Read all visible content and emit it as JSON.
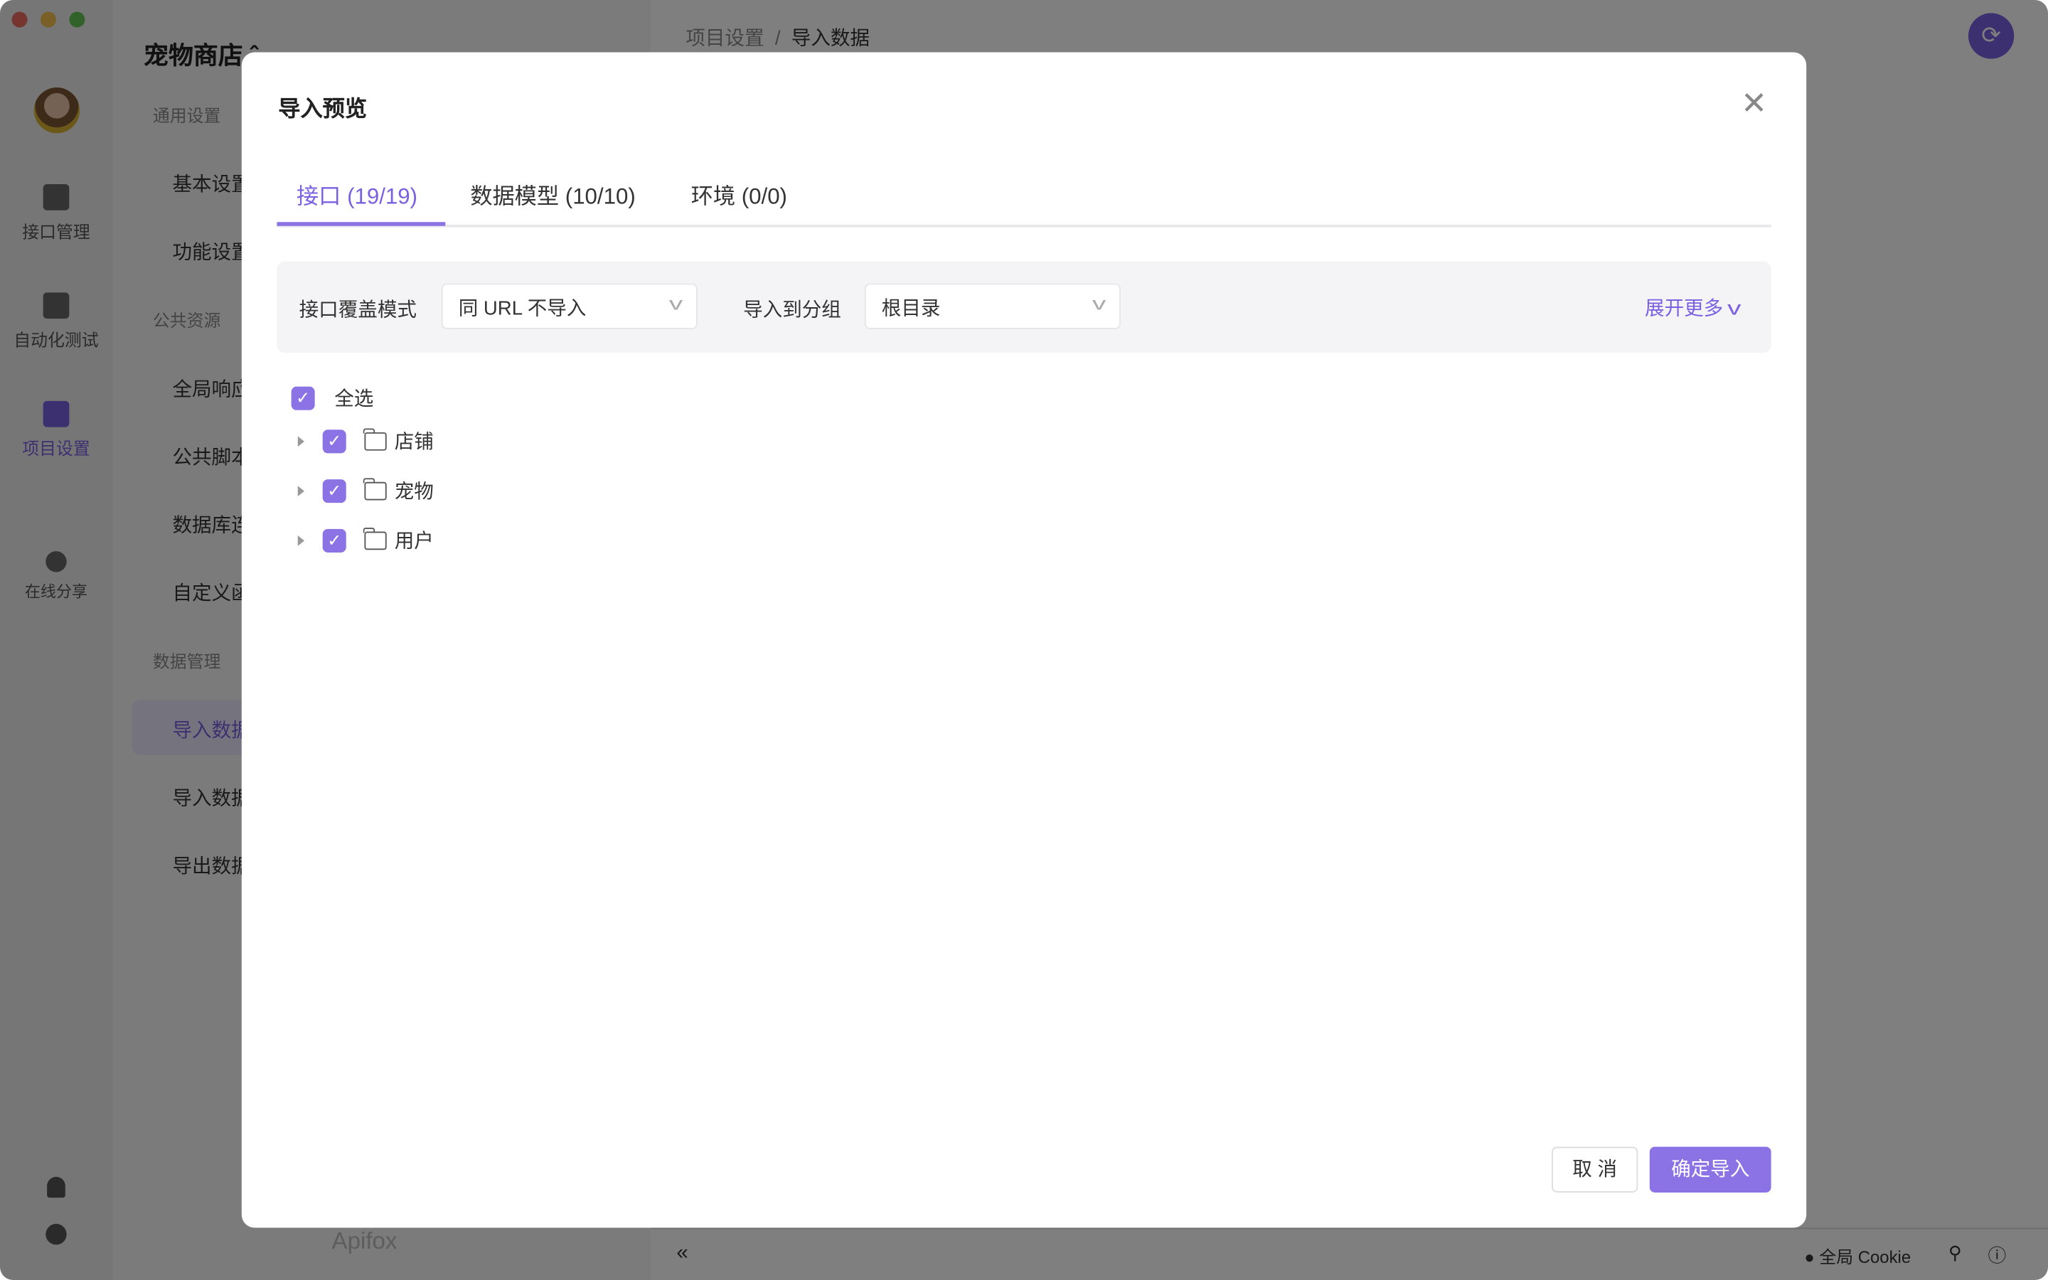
{
  "window": {
    "traffic_lights": [
      "#ee6a5f",
      "#f5be4f",
      "#62c554"
    ]
  },
  "rail": {
    "items": [
      {
        "label": "接口管理",
        "icon": "api-icon"
      },
      {
        "label": "自动化测试",
        "icon": "automation-icon"
      },
      {
        "label": "项目设置",
        "icon": "project-settings-icon",
        "active": true
      },
      {
        "label": "在线分享",
        "icon": "share-icon"
      }
    ]
  },
  "sidebar": {
    "project_name": "宠物商店",
    "groups": [
      {
        "title": "通用设置",
        "items": [
          "基本设置",
          "功能设置"
        ]
      },
      {
        "title": "公共资源",
        "items": [
          "全局响应",
          "公共脚本",
          "数据库连接",
          "自定义函数"
        ]
      },
      {
        "title": "数据管理",
        "items": [
          "导入数据",
          "导入数据",
          "导出数据"
        ]
      }
    ],
    "logo": "Apifox"
  },
  "breadcrumb": {
    "parent": "项目设置",
    "current": "导入数据"
  },
  "footer": {
    "cookie": "全局 Cookie"
  },
  "modal": {
    "title": "导入预览",
    "tabs": [
      {
        "label": "接口 (19/19)",
        "active": true
      },
      {
        "label": "数据模型 (10/10)"
      },
      {
        "label": "环境 (0/0)"
      }
    ],
    "filter": {
      "override_label": "接口覆盖模式",
      "override_value": "同 URL 不导入",
      "group_label": "导入到分组",
      "group_value": "根目录",
      "expand_label": "展开更多"
    },
    "select_all": "全选",
    "folders": [
      {
        "name": "店铺",
        "checked": true
      },
      {
        "name": "宠物",
        "checked": true
      },
      {
        "name": "用户",
        "checked": true
      }
    ],
    "cancel": "取 消",
    "confirm": "确定导入"
  },
  "colors": {
    "accent": "#8b73e6"
  }
}
